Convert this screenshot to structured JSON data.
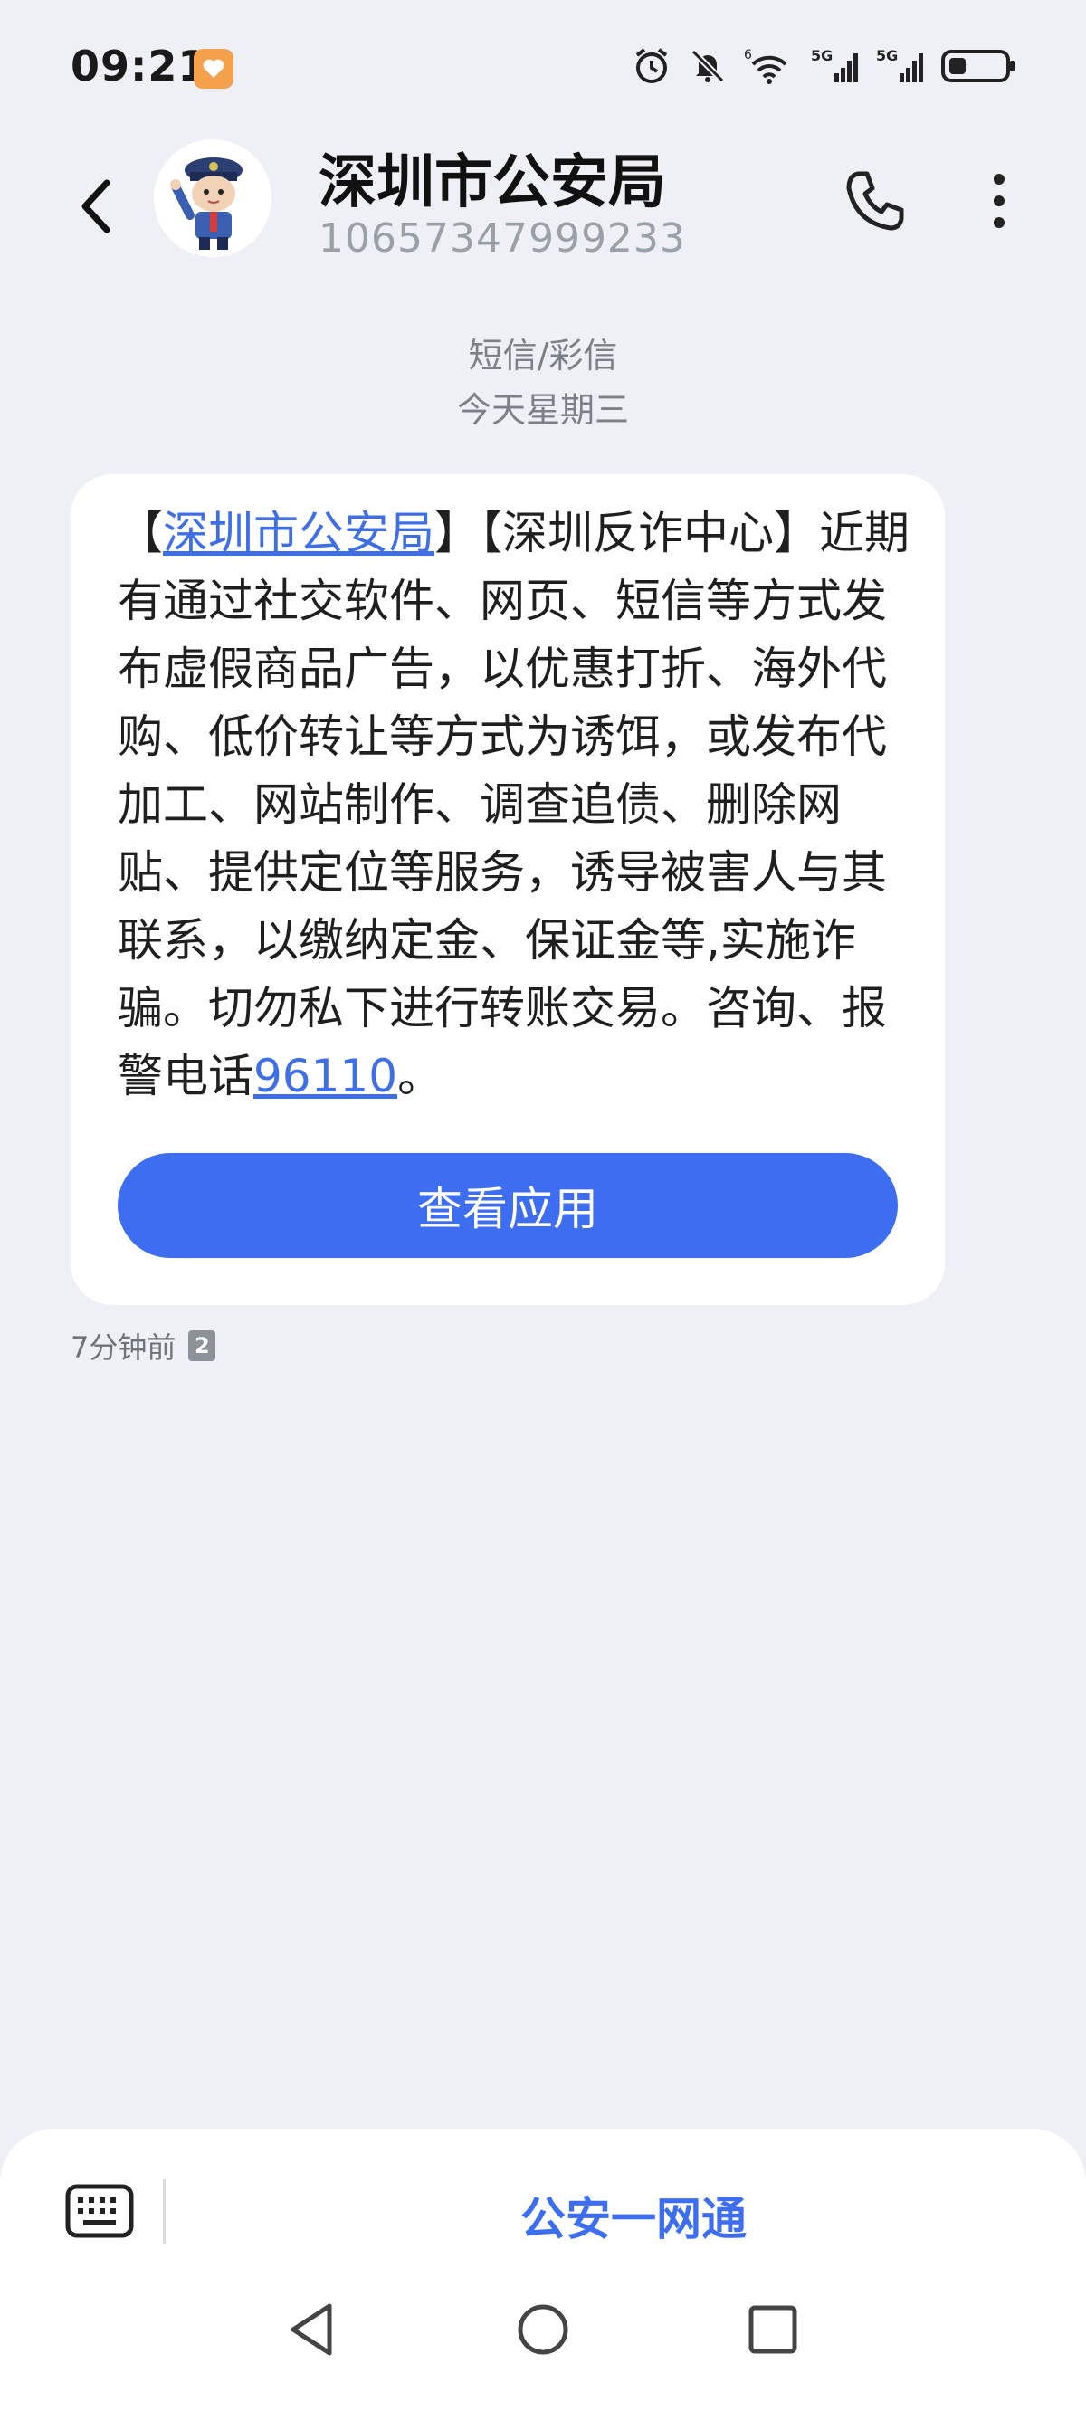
{
  "status_bar": {
    "time": "09:21",
    "app_badge_color": "#f5a04a",
    "icons": [
      "alarm-icon",
      "mute-icon",
      "wifi-icon",
      "signal-5g-icon",
      "signal-5g-icon",
      "battery-icon"
    ],
    "network_labels": [
      "5G",
      "5G"
    ],
    "wifi_label": "6"
  },
  "header": {
    "title": "深圳市公安局",
    "number": "10657347999233"
  },
  "meta": {
    "channel": "短信/彩信",
    "date": "今天星期三"
  },
  "message": {
    "bracket_open": "【",
    "sender_link": "深圳市公安局",
    "body": "】【深圳反诈中心】近期有通过社交软件、网页、短信等方式发布虚假商品广告，以优惠打折、海外代购、低价转让等方式为诱饵，或发布代加工、网站制作、调查追债、删除网贴、提供定位等服务，诱导被害人与其联系，以缴纳定金、保证金等,实施诈骗。切勿私下进行转账交易。咨询、报警电话",
    "phone_link": "96110",
    "tail": "。",
    "button_label": "查看应用",
    "time_ago": "7分钟前",
    "sim_slot": "2"
  },
  "bottom": {
    "quick_action": "公安一网通"
  },
  "colors": {
    "accent": "#3d6ef2",
    "link": "#3f6fe6",
    "background": "#eef0f5"
  }
}
